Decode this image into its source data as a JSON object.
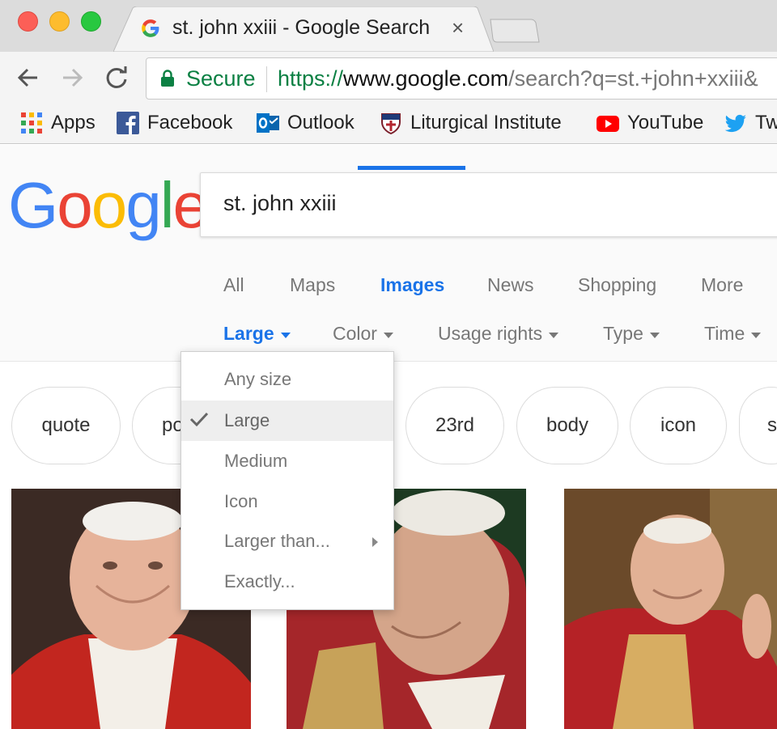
{
  "browser": {
    "tab": {
      "title": "st. john xxiii - Google Search",
      "close": "×"
    },
    "omnibox": {
      "secure_label": "Secure",
      "url_scheme": "https://",
      "url_host": "www.google.com",
      "url_path": "/search?q=st.+john+xxiii&"
    },
    "bookmarks": [
      {
        "label": "Apps",
        "icon": "apps-grid-icon"
      },
      {
        "label": "Facebook",
        "icon": "facebook-icon"
      },
      {
        "label": "Outlook",
        "icon": "outlook-icon"
      },
      {
        "label": "Liturgical Institute",
        "icon": "liturgical-institute-crest-icon"
      },
      {
        "label": "YouTube",
        "icon": "youtube-icon"
      },
      {
        "label": "Tw",
        "icon": "twitter-icon"
      }
    ]
  },
  "google": {
    "logo": {
      "letters": [
        "G",
        "o",
        "o",
        "g",
        "l",
        "e"
      ]
    },
    "search_query": "st. john xxiii",
    "tabs": [
      "All",
      "Maps",
      "Images",
      "News",
      "Shopping",
      "More"
    ],
    "active_tab": "Images",
    "tools": [
      "Large",
      "Color",
      "Usage rights",
      "Type",
      "Time"
    ],
    "chips": [
      "quote",
      "po",
      "23rd",
      "body",
      "icon",
      "s"
    ],
    "size_menu": {
      "items": [
        "Any size",
        "Large",
        "Medium",
        "Icon",
        "Larger than...",
        "Exactly..."
      ],
      "selected": "Large"
    }
  },
  "colors": {
    "accent_blue": "#1a73e8",
    "secure_green": "#0b8043",
    "google_blue": "#4285f4",
    "google_red": "#ea4335",
    "google_yellow": "#fbbc05",
    "google_green": "#34a853"
  }
}
